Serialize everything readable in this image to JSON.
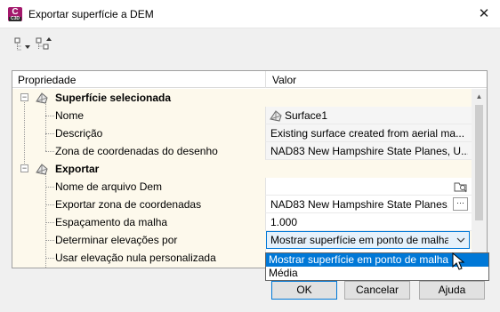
{
  "window": {
    "title": "Exportar superfície a DEM",
    "app_icon_text": "C",
    "app_icon_sub": "C3D",
    "close_glyph": "✕"
  },
  "toolbar": {
    "expand_icon": "expand-all-icon",
    "collapse_icon": "collapse-all-icon"
  },
  "grid": {
    "headers": {
      "property": "Propriedade",
      "value": "Valor"
    },
    "sections": [
      {
        "label": "Superfície selecionada",
        "rows": [
          {
            "label": "Nome",
            "value": "Surface1",
            "icon": "surface-icon"
          },
          {
            "label": "Descrição",
            "value": "Existing surface created from aerial ma..."
          },
          {
            "label": "Zona de coordenadas do desenho",
            "value": "NAD83 New Hampshire State Planes, U..."
          }
        ]
      },
      {
        "label": "Exportar",
        "rows": [
          {
            "label": "Nome de arquivo Dem",
            "value": ""
          },
          {
            "label": "Exportar zona de coordenadas",
            "value": "NAD83 New Hampshire State Planes,...",
            "button": "···"
          },
          {
            "label": "Espaçamento da malha",
            "value": "1.000"
          },
          {
            "label": "Determinar elevações por",
            "value": "Mostrar superfície em ponto de malha"
          },
          {
            "label": "Usar elevação nula personalizada",
            "value": ""
          }
        ]
      }
    ]
  },
  "dropdown": {
    "options": [
      "Mostrar superfície em ponto de malha",
      "Média"
    ],
    "selected_index": 0
  },
  "buttons": {
    "ok": "OK",
    "cancel": "Cancelar",
    "help": "Ajuda"
  },
  "colors": {
    "accent": "#0078d7",
    "row_background": "#fdf9ec",
    "app_icon": "#a3186c"
  }
}
